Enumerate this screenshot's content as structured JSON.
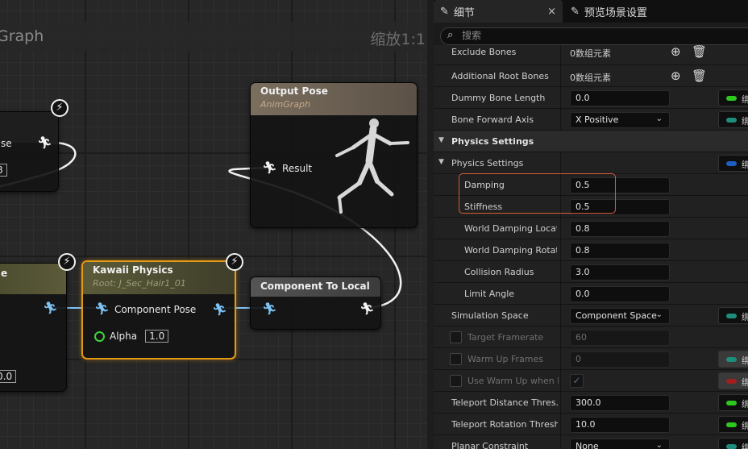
{
  "graph": {
    "title": "Graph",
    "zoom": "缩放1:1",
    "nodes": {
      "left_top": {
        "pin_label": "se",
        "value": "8"
      },
      "left_bottom": {
        "title": "e",
        "value": "0.0"
      },
      "output_pose": {
        "title": "Output Pose",
        "subtitle": "AnimGraph",
        "pin_label": "Result"
      },
      "kawaii": {
        "title": "Kawaii Physics",
        "subtitle": "Root: J_Sec_Hair1_01",
        "pin_label": "Component Pose",
        "alpha_label": "Alpha",
        "alpha_value": "1.0"
      },
      "component_to_local": {
        "title": "Component To Local"
      }
    }
  },
  "panel": {
    "tabs": {
      "details": "细节",
      "close": "×",
      "preview": "预览场景设置"
    },
    "search": {
      "placeholder": "搜索"
    },
    "rows": [
      {
        "label": "Exclude Bones",
        "value": "0数组元素"
      },
      {
        "label": "Additional Root Bones",
        "value": "0数组元素"
      },
      {
        "label": "Dummy Bone Length",
        "value": "0.0",
        "bind": "绑"
      },
      {
        "label": "Bone Forward Axis",
        "value": "X Positive",
        "bind": "绑"
      },
      {
        "label": "Physics Settings"
      },
      {
        "label": "Physics Settings",
        "bind": "绑"
      },
      {
        "label": "Damping",
        "value": "0.5"
      },
      {
        "label": "Stiffness",
        "value": "0.5"
      },
      {
        "label": "World Damping Locati...",
        "value": "0.8"
      },
      {
        "label": "World Damping Rotati...",
        "value": "0.8"
      },
      {
        "label": "Collision Radius",
        "value": "3.0"
      },
      {
        "label": "Limit Angle",
        "value": "0.0"
      },
      {
        "label": "Simulation Space",
        "value": "Component Space",
        "bind": "绑"
      },
      {
        "label": "Target Framerate",
        "value": "60"
      },
      {
        "label": "Warm Up Frames",
        "value": "0",
        "bind": "绑"
      },
      {
        "label": "Use Warm Up when Re",
        "value": "✓",
        "bind": "绑"
      },
      {
        "label": "Teleport Distance Thres...",
        "value": "300.0",
        "bind": "绑"
      },
      {
        "label": "Teleport Rotation Thresh...",
        "value": "10.0",
        "bind": "绑"
      },
      {
        "label": "Planar Constraint",
        "value": "None",
        "bind": "绑"
      }
    ]
  },
  "colors": {
    "kawaii_header": "#5b5b3a",
    "kawaii_border": "#e59a16",
    "output_header": "#6d6253",
    "pin_blue": "#7ec3f5",
    "highlight_border": "#d85a3c",
    "bind_green": "#2ec81f",
    "bind_teal": "#1f8d7c",
    "bind_blue": "#1d5ec0",
    "bind_red": "#a01f1f"
  }
}
